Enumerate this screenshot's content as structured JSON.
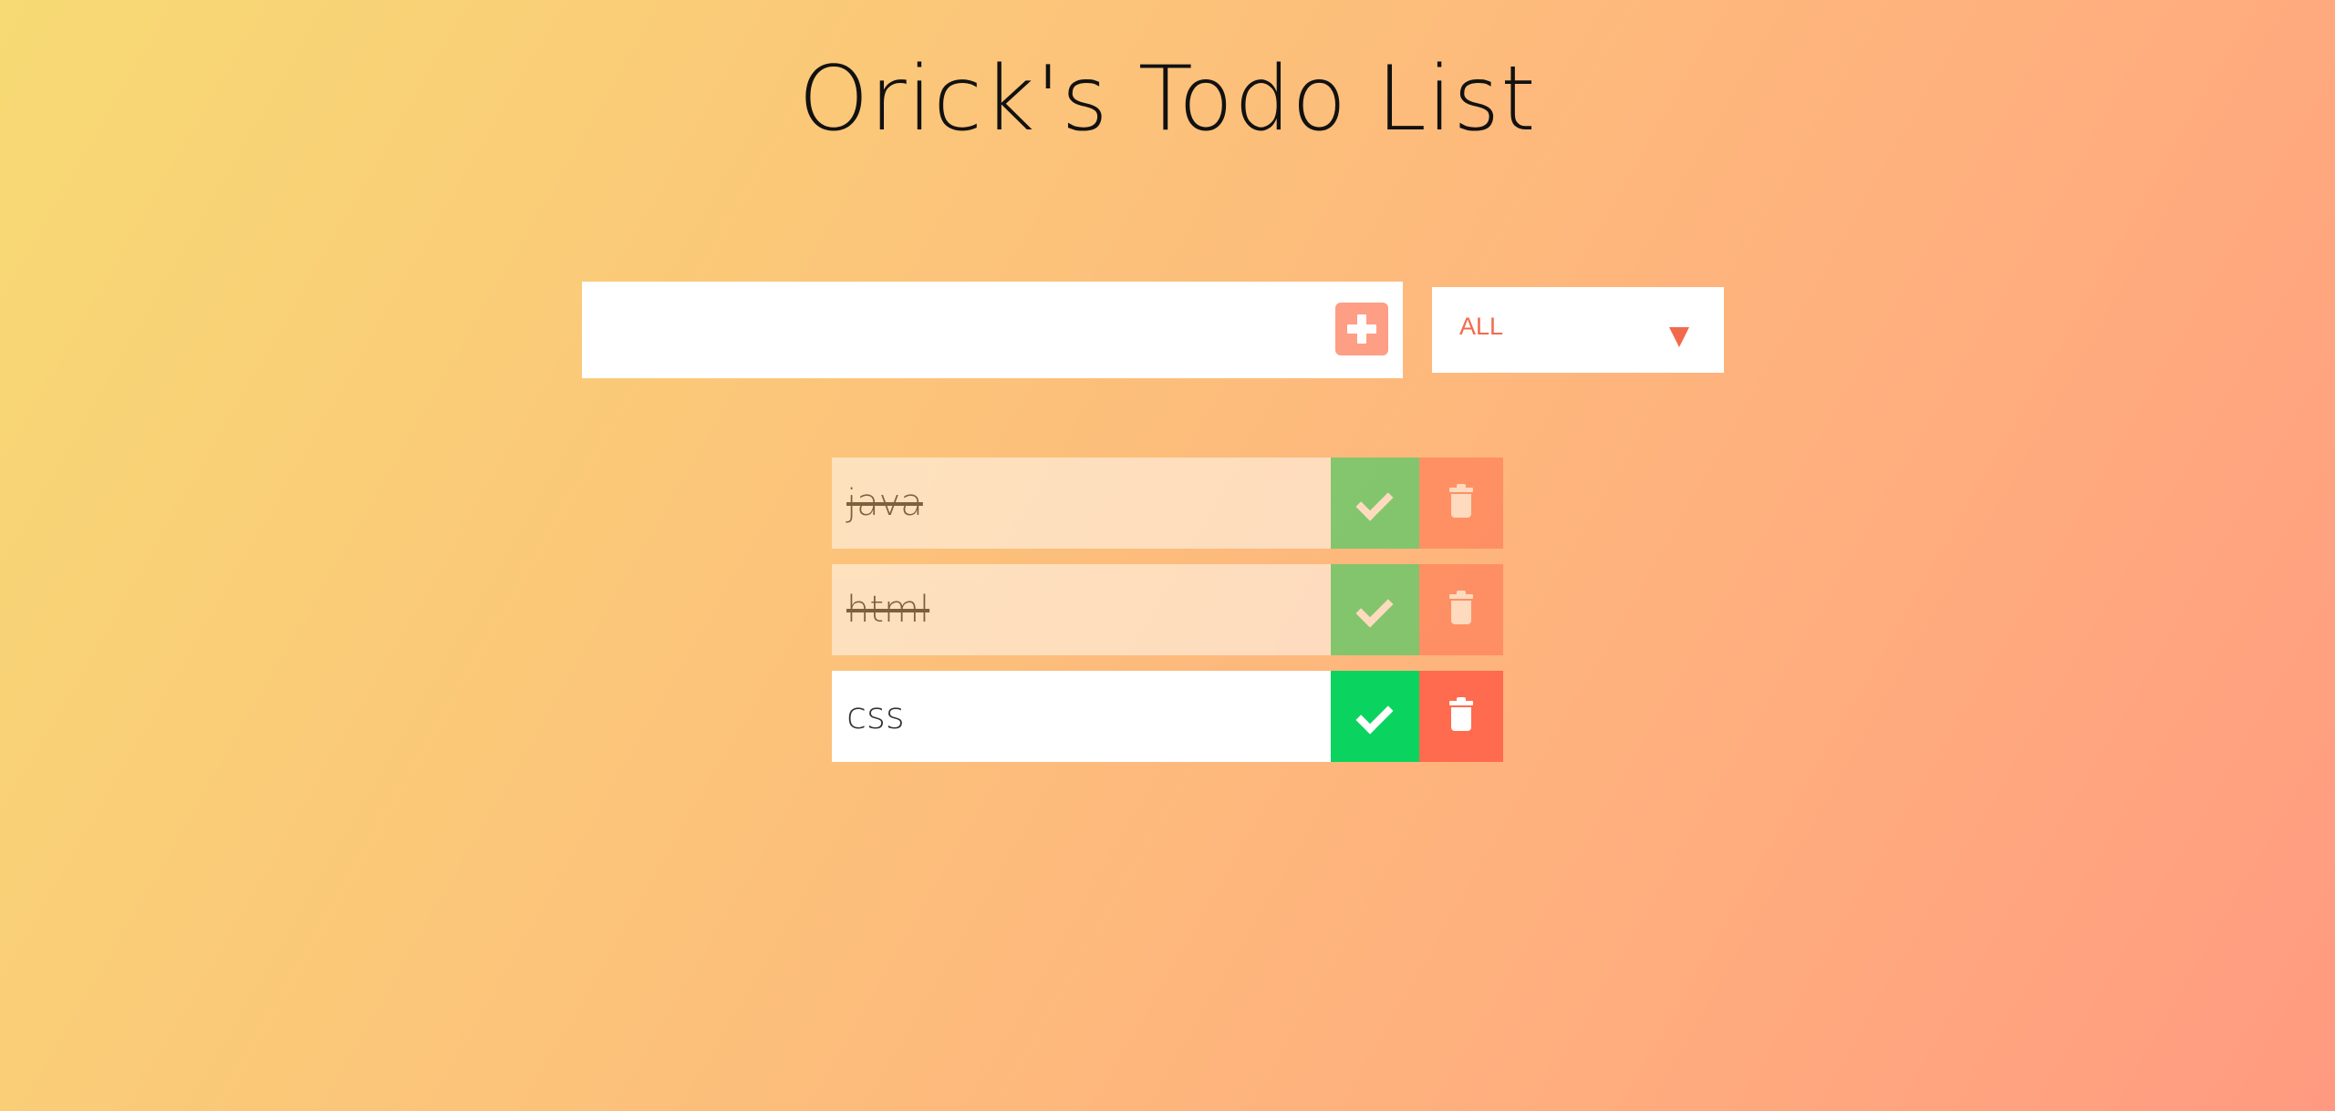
{
  "header": {
    "title": "Orick's Todo List"
  },
  "add_form": {
    "input_value": "",
    "input_placeholder": ""
  },
  "filter": {
    "selected": "ALL"
  },
  "todos": [
    {
      "text": "java",
      "completed": true
    },
    {
      "text": "html",
      "completed": true
    },
    {
      "text": "css",
      "completed": false
    }
  ],
  "colors": {
    "accent": "#f26a4b",
    "complete_green": "#0bd35f",
    "trash_red": "#ff6b4e",
    "add_button": "#fd9e85",
    "gradient_start": "#f7da74",
    "gradient_end": "#ff9a80"
  },
  "icons": {
    "add": "plus-icon",
    "filter": "triangle-down-icon",
    "complete": "check-icon",
    "delete": "trash-icon"
  }
}
